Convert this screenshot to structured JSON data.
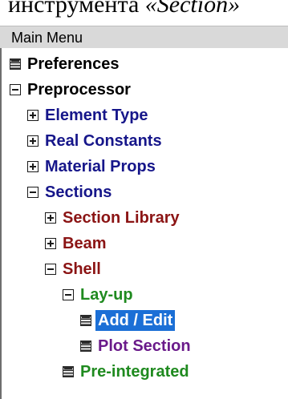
{
  "caption": {
    "prefix": "инструмента ",
    "emphasis": "«Section»"
  },
  "window": {
    "title": "Main Menu"
  },
  "colors": {
    "level0": "#000000",
    "level1": "#16168a",
    "level2": "#8b1414",
    "level3": "#1f8a1f",
    "level4": "#6a1a8a",
    "selection": "#1b6fd6"
  },
  "tree": [
    {
      "label": "Preferences",
      "icon": "document-icon",
      "state": "leaf"
    },
    {
      "label": "Preprocessor",
      "icon": "minus-box-icon",
      "state": "expanded"
    },
    {
      "label": "Element Type",
      "icon": "plus-box-icon",
      "state": "collapsed"
    },
    {
      "label": "Real Constants",
      "icon": "plus-box-icon",
      "state": "collapsed"
    },
    {
      "label": "Material Props",
      "icon": "plus-box-icon",
      "state": "collapsed"
    },
    {
      "label": "Sections",
      "icon": "minus-box-icon",
      "state": "expanded"
    },
    {
      "label": "Section Library",
      "icon": "plus-box-icon",
      "state": "collapsed"
    },
    {
      "label": "Beam",
      "icon": "plus-box-icon",
      "state": "collapsed"
    },
    {
      "label": "Shell",
      "icon": "minus-box-icon",
      "state": "expanded"
    },
    {
      "label": "Lay-up",
      "icon": "minus-box-icon",
      "state": "expanded"
    },
    {
      "label": "Add / Edit",
      "icon": "document-icon",
      "state": "selected"
    },
    {
      "label": "Plot Section",
      "icon": "document-icon",
      "state": "leaf"
    },
    {
      "label": "Pre-integrated",
      "icon": "document-icon",
      "state": "leaf"
    }
  ]
}
